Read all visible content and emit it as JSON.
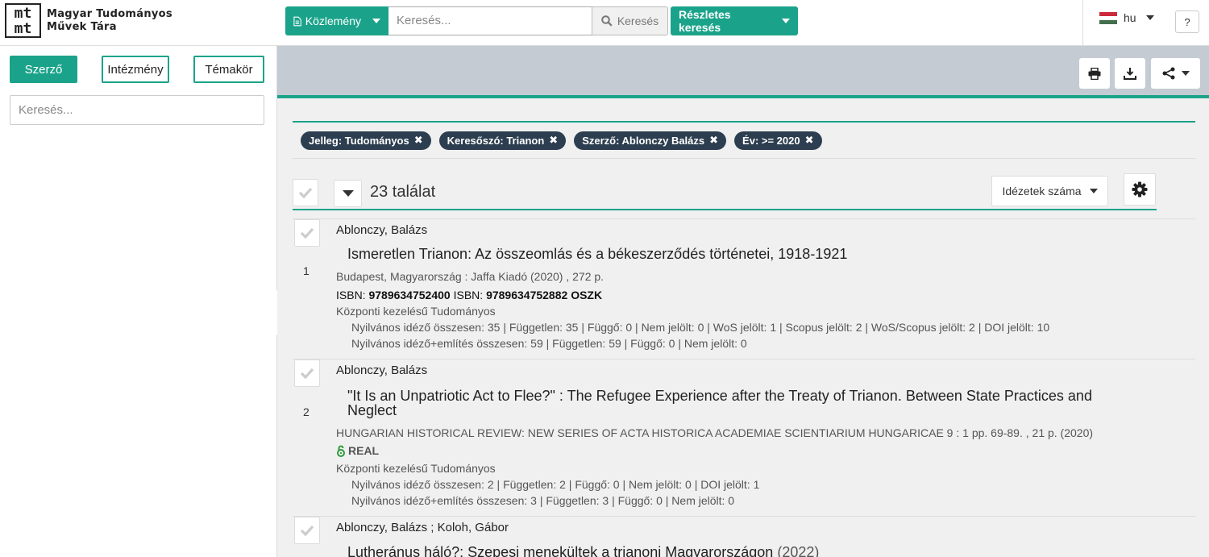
{
  "app": {
    "logo_line1": "mt",
    "logo_line2": "mt",
    "name_line1": "Magyar Tudományos",
    "name_line2": "Művek Tára"
  },
  "topbar": {
    "type_dropdown_label": "Közlemény",
    "search_placeholder": "Keresés...",
    "search_button_label": "Keresés",
    "advanced_search_label": "Részletes keresés",
    "language": "hu",
    "help_label": "?"
  },
  "sidebar": {
    "tabs": [
      {
        "label": "Szerző",
        "active": true
      },
      {
        "label": "Intézmény",
        "active": false
      },
      {
        "label": "Témakör",
        "active": false
      }
    ],
    "search_placeholder": "Keresés..."
  },
  "filters": [
    {
      "label": "Jelleg: Tudományos"
    },
    {
      "label": "Keresőszó: Trianon"
    },
    {
      "label": "Szerző: Ablonczy Balázs"
    },
    {
      "label": "Év: >= 2020"
    }
  ],
  "results": {
    "count_label": "23 találat",
    "sort_label": "Idézetek száma",
    "items": [
      {
        "number": "1",
        "authors": "Ablonczy, Balázs",
        "title": "Ismeretlen Trianon: Az összeomlás és a békeszerződés történetei, 1918-1921",
        "publisher": "Budapest, Magyarország : Jaffa Kiadó (2020) , 272 p.",
        "isbn_label_1": "ISBN:",
        "isbn_1": "9789634752400",
        "isbn_label_2": "ISBN:",
        "isbn_2": "9789634752882",
        "oszk": "OSZK",
        "category": "Központi kezelésű Tudományos",
        "stats_1": "Nyilvános idéző összesen: 35 | Független: 35 | Függő: 0 | Nem jelölt: 0 | WoS jelölt: 1 | Scopus jelölt: 2 | WoS/Scopus jelölt: 2 | DOI jelölt: 10",
        "stats_2": "Nyilvános idéző+említés összesen: 59 | Független: 59 | Függő: 0 | Nem jelölt: 0"
      },
      {
        "number": "2",
        "authors": "Ablonczy, Balázs",
        "title": "\"It Is an Unpatriotic Act to Flee?\" : The Refugee Experience after the Treaty of Trianon. Between State Practices and Neglect",
        "publisher": "HUNGARIAN HISTORICAL REVIEW: NEW SERIES OF ACTA HISTORICA ACADEMIAE SCIENTIARIUM HUNGARICAE 9 : 1 pp. 69-89. , 21 p. (2020)",
        "repository": "REAL",
        "category": "Központi kezelésű Tudományos",
        "stats_1": "Nyilvános idéző összesen: 2 | Független: 2 | Függő: 0 | Nem jelölt: 0 | DOI jelölt: 1",
        "stats_2": "Nyilvános idéző+említés összesen: 3 | Független: 3 | Függő: 0 | Nem jelölt: 0"
      },
      {
        "authors": "Ablonczy, Balázs ; Koloh, Gábor",
        "title": "Lutheránus háló?: Szepesi menekültek a trianoni Magyarországon",
        "year": "(2022)"
      }
    ]
  },
  "colors": {
    "accent": "#1aa38a",
    "chip_bg": "#2d3e50",
    "toolbar_bg": "#c4cbd3"
  },
  "icons": [
    "document-icon",
    "search-icon",
    "flag-hu-icon",
    "print-icon",
    "download-icon",
    "share-icon",
    "check-icon",
    "chevron-down-icon",
    "gear-icon",
    "close-icon",
    "open-access-icon",
    "chevron-left-icon"
  ]
}
